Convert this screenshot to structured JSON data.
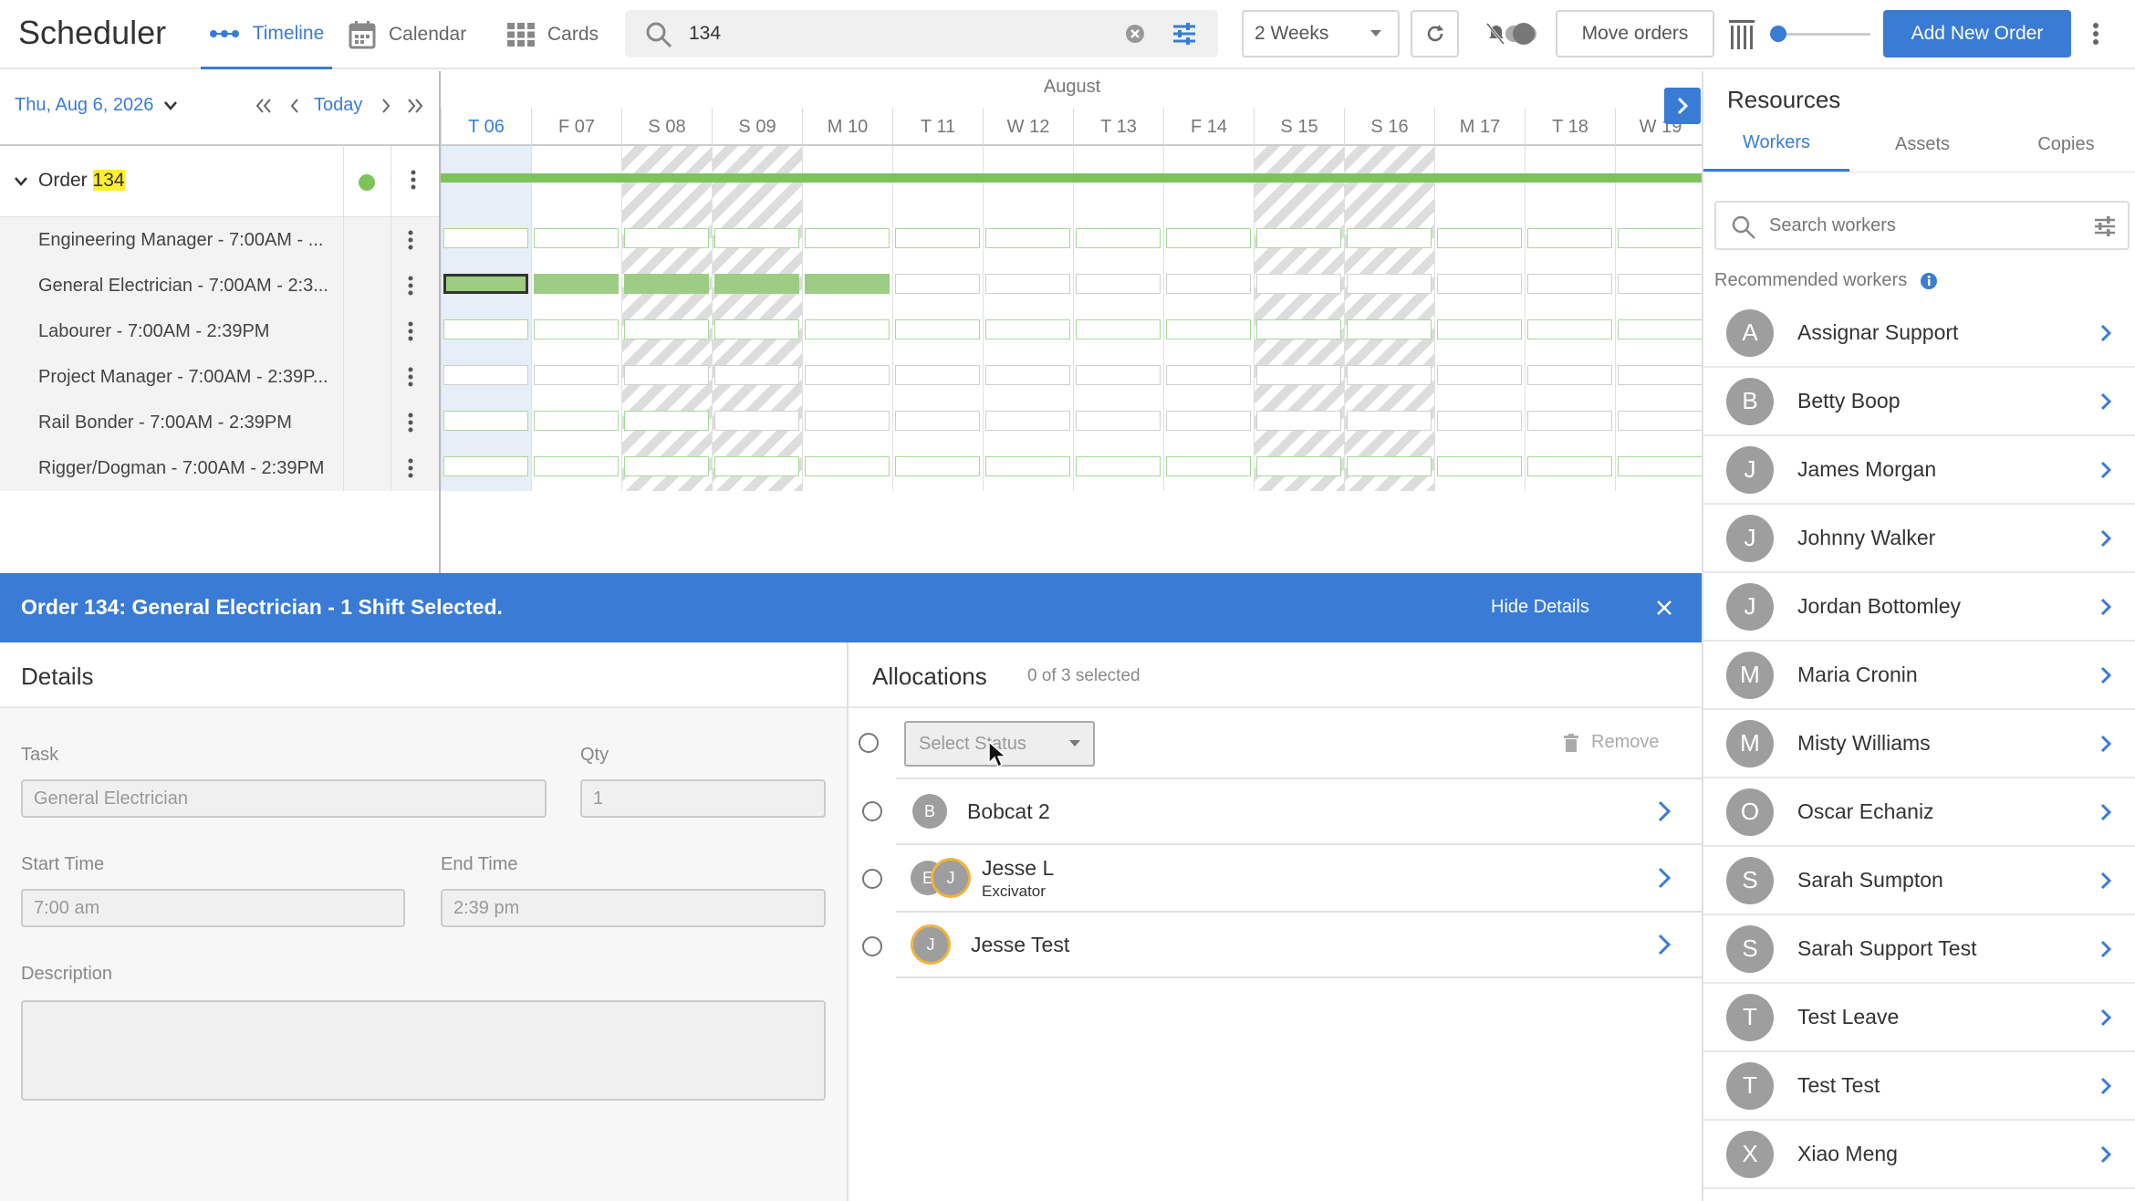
{
  "app": {
    "title": "Scheduler"
  },
  "views": [
    {
      "label": "Timeline",
      "icon": "timeline-icon",
      "active": true
    },
    {
      "label": "Calendar",
      "icon": "calendar-icon",
      "active": false
    },
    {
      "label": "Cards",
      "icon": "grid-icon",
      "active": false
    }
  ],
  "search": {
    "value": "134"
  },
  "toolbar": {
    "range": "2 Weeks",
    "move_orders": "Move orders",
    "add_order": "Add New Order"
  },
  "nav": {
    "date": "Thu, Aug 6, 2026",
    "today": "Today"
  },
  "timeline": {
    "month": "August",
    "days": [
      "T 06",
      "F 07",
      "S 08",
      "S 09",
      "M 10",
      "T 11",
      "W 12",
      "T 13",
      "F 14",
      "S 15",
      "S 16",
      "M 17",
      "T 18",
      "W 19"
    ]
  },
  "order": {
    "label": "Order",
    "number": "134",
    "status_color": "#7dc35b"
  },
  "shifts": [
    {
      "label": "Engineering Manager - 7:00AM - ..."
    },
    {
      "label": "General Electrician - 7:00AM - 2:3..."
    },
    {
      "label": "Labourer - 7:00AM - 2:39PM"
    },
    {
      "label": "Project Manager - 7:00AM - 2:39P..."
    },
    {
      "label": "Rail Bonder - 7:00AM - 2:39PM"
    },
    {
      "label": "Rigger/Dogman - 7:00AM - 2:39PM"
    }
  ],
  "banner": {
    "title": "Order 134: General Electrician - 1 Shift Selected.",
    "hide": "Hide Details"
  },
  "details": {
    "heading": "Details",
    "task_label": "Task",
    "task_value": "General Electrician",
    "qty_label": "Qty",
    "qty_value": "1",
    "start_label": "Start Time",
    "start_value": "7:00 am",
    "end_label": "End Time",
    "end_value": "2:39 pm",
    "description_label": "Description"
  },
  "allocations": {
    "heading": "Allocations",
    "count": "0 of 3 selected",
    "status_placeholder": "Select Status",
    "remove": "Remove",
    "items": [
      {
        "initial": "B",
        "name": "Bobcat 2",
        "sub": ""
      },
      {
        "initial": "J",
        "initial2": "E",
        "name": "Jesse L",
        "sub": "Excivator"
      },
      {
        "initial": "J",
        "name": "Jesse Test",
        "sub": ""
      }
    ]
  },
  "resources": {
    "title": "Resources",
    "tabs": [
      "Workers",
      "Assets",
      "Copies"
    ],
    "search_placeholder": "Search workers",
    "recommended": "Recommended workers",
    "workers": [
      {
        "initial": "A",
        "name": "Assignar Support"
      },
      {
        "initial": "B",
        "name": "Betty Boop"
      },
      {
        "initial": "J",
        "name": "James Morgan"
      },
      {
        "initial": "J",
        "name": "Johnny Walker"
      },
      {
        "initial": "J",
        "name": "Jordan Bottomley"
      },
      {
        "initial": "M",
        "name": "Maria Cronin"
      },
      {
        "initial": "M",
        "name": "Misty Williams"
      },
      {
        "initial": "O",
        "name": "Oscar Echaniz"
      },
      {
        "initial": "S",
        "name": "Sarah Sumpton"
      },
      {
        "initial": "S",
        "name": "Sarah Support Test"
      },
      {
        "initial": "T",
        "name": "Test Leave"
      },
      {
        "initial": "T",
        "name": "Test Test"
      },
      {
        "initial": "X",
        "name": "Xiao Meng"
      }
    ]
  },
  "colors": {
    "accent": "#3a7bd5",
    "green": "#9ccd82",
    "highlight": "#ffee33"
  }
}
